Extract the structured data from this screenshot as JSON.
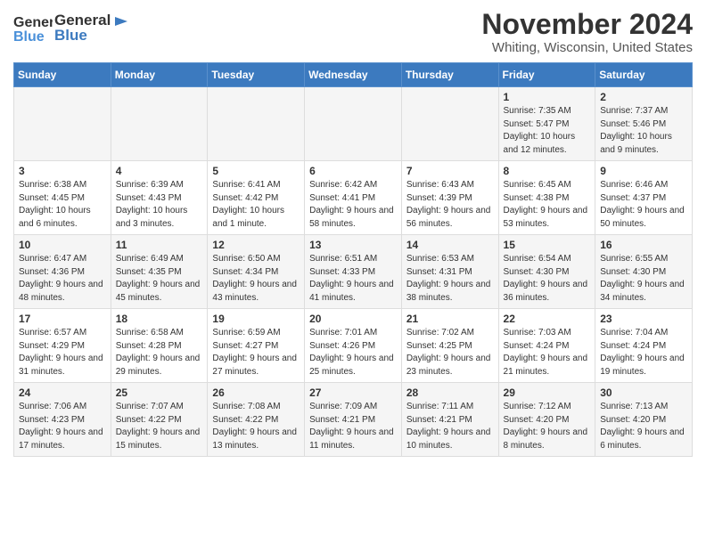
{
  "header": {
    "logo_general": "General",
    "logo_blue": "Blue",
    "title": "November 2024",
    "location": "Whiting, Wisconsin, United States"
  },
  "weekdays": [
    "Sunday",
    "Monday",
    "Tuesday",
    "Wednesday",
    "Thursday",
    "Friday",
    "Saturday"
  ],
  "weeks": [
    [
      {
        "day": "",
        "info": ""
      },
      {
        "day": "",
        "info": ""
      },
      {
        "day": "",
        "info": ""
      },
      {
        "day": "",
        "info": ""
      },
      {
        "day": "",
        "info": ""
      },
      {
        "day": "1",
        "info": "Sunrise: 7:35 AM\nSunset: 5:47 PM\nDaylight: 10 hours and 12 minutes."
      },
      {
        "day": "2",
        "info": "Sunrise: 7:37 AM\nSunset: 5:46 PM\nDaylight: 10 hours and 9 minutes."
      }
    ],
    [
      {
        "day": "3",
        "info": "Sunrise: 6:38 AM\nSunset: 4:45 PM\nDaylight: 10 hours and 6 minutes."
      },
      {
        "day": "4",
        "info": "Sunrise: 6:39 AM\nSunset: 4:43 PM\nDaylight: 10 hours and 3 minutes."
      },
      {
        "day": "5",
        "info": "Sunrise: 6:41 AM\nSunset: 4:42 PM\nDaylight: 10 hours and 1 minute."
      },
      {
        "day": "6",
        "info": "Sunrise: 6:42 AM\nSunset: 4:41 PM\nDaylight: 9 hours and 58 minutes."
      },
      {
        "day": "7",
        "info": "Sunrise: 6:43 AM\nSunset: 4:39 PM\nDaylight: 9 hours and 56 minutes."
      },
      {
        "day": "8",
        "info": "Sunrise: 6:45 AM\nSunset: 4:38 PM\nDaylight: 9 hours and 53 minutes."
      },
      {
        "day": "9",
        "info": "Sunrise: 6:46 AM\nSunset: 4:37 PM\nDaylight: 9 hours and 50 minutes."
      }
    ],
    [
      {
        "day": "10",
        "info": "Sunrise: 6:47 AM\nSunset: 4:36 PM\nDaylight: 9 hours and 48 minutes."
      },
      {
        "day": "11",
        "info": "Sunrise: 6:49 AM\nSunset: 4:35 PM\nDaylight: 9 hours and 45 minutes."
      },
      {
        "day": "12",
        "info": "Sunrise: 6:50 AM\nSunset: 4:34 PM\nDaylight: 9 hours and 43 minutes."
      },
      {
        "day": "13",
        "info": "Sunrise: 6:51 AM\nSunset: 4:33 PM\nDaylight: 9 hours and 41 minutes."
      },
      {
        "day": "14",
        "info": "Sunrise: 6:53 AM\nSunset: 4:31 PM\nDaylight: 9 hours and 38 minutes."
      },
      {
        "day": "15",
        "info": "Sunrise: 6:54 AM\nSunset: 4:30 PM\nDaylight: 9 hours and 36 minutes."
      },
      {
        "day": "16",
        "info": "Sunrise: 6:55 AM\nSunset: 4:30 PM\nDaylight: 9 hours and 34 minutes."
      }
    ],
    [
      {
        "day": "17",
        "info": "Sunrise: 6:57 AM\nSunset: 4:29 PM\nDaylight: 9 hours and 31 minutes."
      },
      {
        "day": "18",
        "info": "Sunrise: 6:58 AM\nSunset: 4:28 PM\nDaylight: 9 hours and 29 minutes."
      },
      {
        "day": "19",
        "info": "Sunrise: 6:59 AM\nSunset: 4:27 PM\nDaylight: 9 hours and 27 minutes."
      },
      {
        "day": "20",
        "info": "Sunrise: 7:01 AM\nSunset: 4:26 PM\nDaylight: 9 hours and 25 minutes."
      },
      {
        "day": "21",
        "info": "Sunrise: 7:02 AM\nSunset: 4:25 PM\nDaylight: 9 hours and 23 minutes."
      },
      {
        "day": "22",
        "info": "Sunrise: 7:03 AM\nSunset: 4:24 PM\nDaylight: 9 hours and 21 minutes."
      },
      {
        "day": "23",
        "info": "Sunrise: 7:04 AM\nSunset: 4:24 PM\nDaylight: 9 hours and 19 minutes."
      }
    ],
    [
      {
        "day": "24",
        "info": "Sunrise: 7:06 AM\nSunset: 4:23 PM\nDaylight: 9 hours and 17 minutes."
      },
      {
        "day": "25",
        "info": "Sunrise: 7:07 AM\nSunset: 4:22 PM\nDaylight: 9 hours and 15 minutes."
      },
      {
        "day": "26",
        "info": "Sunrise: 7:08 AM\nSunset: 4:22 PM\nDaylight: 9 hours and 13 minutes."
      },
      {
        "day": "27",
        "info": "Sunrise: 7:09 AM\nSunset: 4:21 PM\nDaylight: 9 hours and 11 minutes."
      },
      {
        "day": "28",
        "info": "Sunrise: 7:11 AM\nSunset: 4:21 PM\nDaylight: 9 hours and 10 minutes."
      },
      {
        "day": "29",
        "info": "Sunrise: 7:12 AM\nSunset: 4:20 PM\nDaylight: 9 hours and 8 minutes."
      },
      {
        "day": "30",
        "info": "Sunrise: 7:13 AM\nSunset: 4:20 PM\nDaylight: 9 hours and 6 minutes."
      }
    ]
  ]
}
